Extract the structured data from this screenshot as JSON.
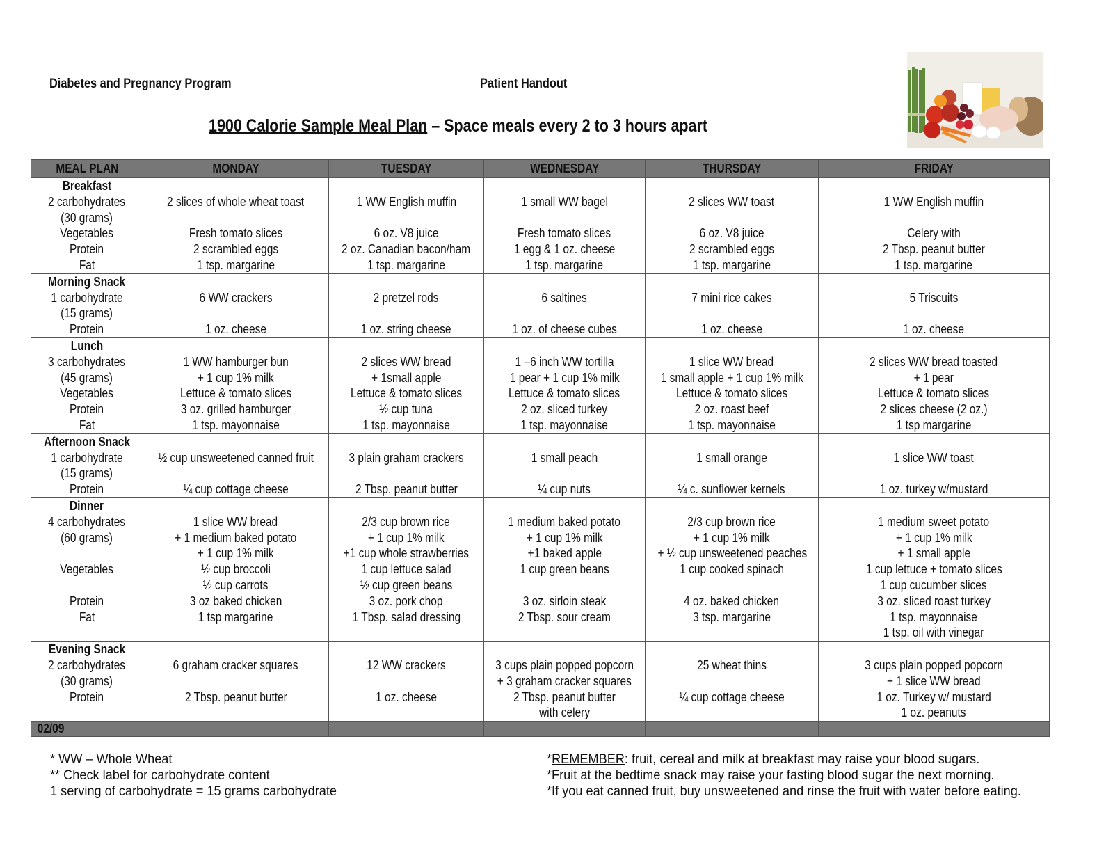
{
  "header": {
    "program": "Diabetes and Pregnancy Program",
    "handout": "Patient Handout",
    "title_underlined": "1900 Calorie Sample Meal Plan",
    "title_rest": " – Space meals every 2 to 3 hours apart",
    "image": "food-photo (vegetables, fruit, milk, cheese, chicken, eggs, bread)"
  },
  "table": {
    "columns": [
      "MEAL PLAN",
      "MONDAY",
      "TUESDAY",
      "WEDNESDAY",
      "THURSDAY",
      "FRIDAY"
    ],
    "rows": [
      {
        "meal": "Breakfast",
        "guide": [
          "2 carbohydrates",
          "(30 grams)",
          "Vegetables",
          "Protein",
          "Fat"
        ],
        "days": [
          [
            "2 slices of whole wheat toast",
            "",
            "Fresh tomato slices",
            "2 scrambled eggs",
            "1 tsp. margarine"
          ],
          [
            "1 WW English muffin",
            "",
            "6 oz. V8 juice",
            "2 oz. Canadian bacon/ham",
            "1 tsp. margarine"
          ],
          [
            "1 small WW bagel",
            "",
            "Fresh tomato slices",
            "1 egg & 1 oz. cheese",
            "1 tsp. margarine"
          ],
          [
            "2 slices WW toast",
            "",
            "6 oz. V8 juice",
            "2 scrambled eggs",
            "1 tsp. margarine"
          ],
          [
            "1 WW English muffin",
            "",
            "Celery with",
            "2 Tbsp. peanut butter",
            "1 tsp. margarine"
          ]
        ]
      },
      {
        "meal": "Morning Snack",
        "guide": [
          "1 carbohydrate",
          "(15 grams)",
          "Protein"
        ],
        "days": [
          [
            "6 WW crackers",
            "",
            "1 oz. cheese"
          ],
          [
            "2 pretzel rods",
            "",
            "1 oz. string cheese"
          ],
          [
            "6 saltines",
            "",
            "1 oz. of cheese cubes"
          ],
          [
            "7 mini rice cakes",
            "",
            "1 oz. cheese"
          ],
          [
            "5 Triscuits",
            "",
            "1 oz. cheese"
          ]
        ]
      },
      {
        "meal": "Lunch",
        "guide": [
          "3 carbohydrates",
          "(45 grams)",
          "Vegetables",
          "Protein",
          "Fat"
        ],
        "days": [
          [
            "1 WW hamburger bun",
            "+ 1 cup 1% milk",
            "Lettuce & tomato slices",
            "3 oz. grilled hamburger",
            "1 tsp. mayonnaise"
          ],
          [
            "2 slices WW bread",
            "+ 1small apple",
            "Lettuce & tomato slices",
            "½ cup tuna",
            "1 tsp. mayonnaise"
          ],
          [
            "1 –6 inch WW tortilla",
            "1 pear + 1 cup 1% milk",
            "Lettuce & tomato slices",
            "2 oz. sliced turkey",
            "1 tsp. mayonnaise"
          ],
          [
            "1 slice WW bread",
            "1 small apple + 1 cup 1% milk",
            "Lettuce & tomato slices",
            "2 oz. roast beef",
            "1 tsp. mayonnaise"
          ],
          [
            "2 slices WW bread toasted",
            "+ 1 pear",
            "Lettuce & tomato slices",
            "2 slices cheese (2 oz.)",
            "1 tsp margarine"
          ]
        ]
      },
      {
        "meal": "Afternoon Snack",
        "guide": [
          "1 carbohydrate",
          "(15 grams)",
          "Protein"
        ],
        "days": [
          [
            "½ cup unsweetened canned fruit",
            "",
            "¼ cup cottage cheese"
          ],
          [
            "3 plain graham crackers",
            "",
            "2 Tbsp. peanut butter"
          ],
          [
            "1 small peach",
            "",
            "¼ cup nuts"
          ],
          [
            "1 small orange",
            "",
            "¼ c. sunflower kernels"
          ],
          [
            "1 slice WW toast",
            "",
            "1 oz. turkey w/mustard"
          ]
        ]
      },
      {
        "meal": "Dinner",
        "guide": [
          "4 carbohydrates",
          "(60 grams)",
          "",
          "Vegetables",
          "",
          "Protein",
          "Fat"
        ],
        "days": [
          [
            "1 slice WW bread",
            "+ 1 medium baked potato",
            "+ 1 cup 1% milk",
            "½ cup broccoli",
            "½ cup carrots",
            "3 oz baked chicken",
            "1 tsp margarine"
          ],
          [
            "2/3 cup brown rice",
            "+ 1 cup 1% milk",
            "+1 cup whole strawberries",
            "1 cup lettuce salad",
            "½ cup green beans",
            "3 oz. pork chop",
            "1 Tbsp. salad dressing"
          ],
          [
            "1 medium baked potato",
            "+ 1 cup 1% milk",
            "+1 baked apple",
            "1 cup green beans",
            "",
            "3 oz. sirloin steak",
            "2 Tbsp. sour cream"
          ],
          [
            "2/3 cup brown rice",
            "+ 1 cup 1% milk",
            "+ ½ cup unsweetened peaches",
            "1 cup cooked spinach",
            "",
            "4 oz. baked chicken",
            "3 tsp. margarine"
          ],
          [
            "1 medium sweet potato",
            "+ 1 cup 1% milk",
            "+ 1 small apple",
            "1 cup lettuce + tomato slices",
            "1 cup cucumber slices",
            "3 oz. sliced roast turkey",
            "1 tsp. mayonnaise",
            "1 tsp. oil with vinegar"
          ]
        ]
      },
      {
        "meal": "Evening Snack",
        "guide": [
          "2 carbohydrates",
          "(30 grams)",
          "Protein"
        ],
        "days": [
          [
            "6 graham cracker squares",
            "",
            "2 Tbsp. peanut butter"
          ],
          [
            "12 WW crackers",
            "",
            "1 oz. cheese"
          ],
          [
            "3 cups plain popped popcorn",
            "+ 3 graham cracker squares",
            "2 Tbsp. peanut butter",
            "with celery"
          ],
          [
            "25 wheat thins",
            "",
            "¼ cup cottage cheese"
          ],
          [
            "3 cups plain popped popcorn",
            "+ 1 slice WW bread",
            "1 oz. Turkey w/ mustard",
            "1 oz. peanuts"
          ]
        ]
      }
    ],
    "date_code": "02/09"
  },
  "footer": {
    "left": [
      "* WW – Whole Wheat",
      "** Check label for carbohydrate content",
      "1 serving of carbohydrate = 15 grams carbohydrate"
    ],
    "right_remember_label": "REMEMBER",
    "right_remember_text": ":  fruit, cereal and milk at breakfast may raise your blood sugars.",
    "right": [
      "*Fruit at the bedtime snack may raise your fasting blood sugar the next morning.",
      "*If you eat canned fruit, buy unsweetened and rinse the fruit with water before eating."
    ]
  },
  "colors": {
    "header_fill": "#777777",
    "border": "#555555",
    "text": "#111111"
  }
}
